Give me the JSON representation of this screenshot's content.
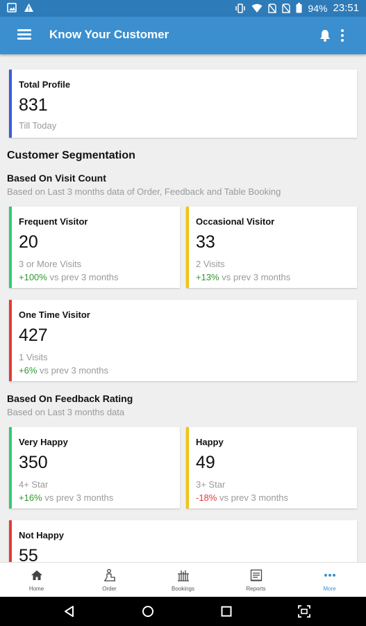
{
  "status_bar": {
    "battery": "94%",
    "time": "23:51"
  },
  "app_bar": {
    "title": "Know Your Customer"
  },
  "total_profile": {
    "title": "Total Profile",
    "value": "831",
    "sub": "Till Today",
    "accent": "#3b5bdb"
  },
  "segmentation": {
    "heading": "Customer Segmentation",
    "visit": {
      "heading": "Based On Visit Count",
      "caption": "Based on Last 3 months data of Order, Feedback and Table Booking",
      "cards": [
        {
          "title": "Frequent Visitor",
          "value": "20",
          "sub": "3 or More Visits",
          "change": "+100%",
          "suffix": " vs prev 3 months",
          "accent": "#2ecc71",
          "trend": "up"
        },
        {
          "title": "Occasional Visitor",
          "value": "33",
          "sub": "2 Visits",
          "change": "+13%",
          "suffix": " vs prev 3 months",
          "accent": "#f1c40f",
          "trend": "up"
        },
        {
          "title": "One Time Visitor",
          "value": "427",
          "sub": "1 Visits",
          "change": "+6%",
          "suffix": " vs prev 3 months",
          "accent": "#e53935",
          "trend": "up"
        }
      ]
    },
    "feedback": {
      "heading": "Based On Feedback Rating",
      "caption": "Based on Last 3 months data",
      "cards": [
        {
          "title": "Very Happy",
          "value": "350",
          "sub": "4+ Star",
          "change": "+16%",
          "suffix": " vs prev 3 months",
          "accent": "#2ecc71",
          "trend": "up"
        },
        {
          "title": "Happy",
          "value": "49",
          "sub": "3+ Star",
          "change": "-18%",
          "suffix": " vs prev 3 months",
          "accent": "#f1c40f",
          "trend": "down"
        },
        {
          "title": "Not Happy",
          "value": "55",
          "accent": "#e53935"
        }
      ]
    }
  },
  "bottom_nav": [
    {
      "label": "Home",
      "icon": "home-icon"
    },
    {
      "label": "Order",
      "icon": "order-icon"
    },
    {
      "label": "Bookings",
      "icon": "bookings-icon"
    },
    {
      "label": "Reports",
      "icon": "reports-icon"
    },
    {
      "label": "More",
      "icon": "more-icon",
      "active": true
    }
  ]
}
